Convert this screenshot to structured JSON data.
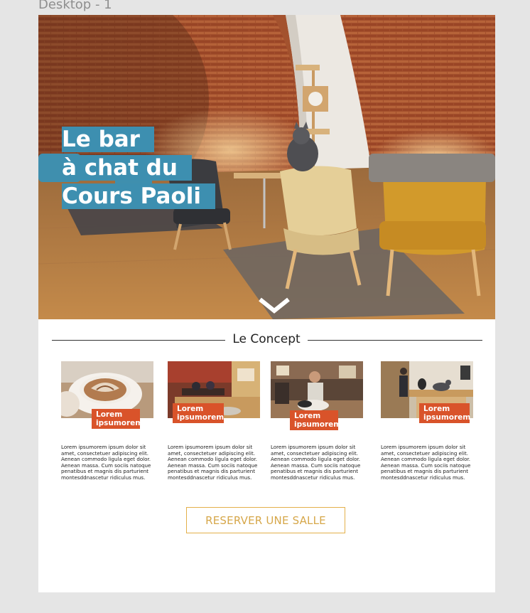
{
  "canvas": {
    "frame_label": "Desktop - 1"
  },
  "hero": {
    "title_lines": [
      "Le bar",
      "à chat du",
      "Cours Paoli"
    ],
    "scroll_icon": "chevron-down-icon"
  },
  "concept": {
    "heading": "Le Concept",
    "cards": [
      {
        "tag": "Lorem ipsumorem",
        "photo": "coffee-cup-photo",
        "desc": "Lorem ipsumorem ipsum dolor sit amet, consectetuer adipiscing elit. Aenean commodo ligula eget dolor. Aenean massa. Cum sociis natoque penatibus et magnis dis parturient montesddnascetur ridiculus mus."
      },
      {
        "tag": "Lorem ipsumorem",
        "photo": "cafe-interior-photo",
        "desc": "Lorem ipsumorem ipsum dolor sit amet, consectetuer adipiscing elit. Aenean commodo ligula eget dolor. Aenean massa. Cum sociis natoque penatibus et magnis dis parturient montesddnascetur ridiculus mus."
      },
      {
        "tag": "Lorem ipsumorem",
        "photo": "woman-with-cats-photo",
        "desc": "Lorem ipsumorem ipsum dolor sit amet, consectetuer adipiscing elit. Aenean commodo ligula eget dolor. Aenean massa. Cum sociis natoque penatibus et magnis dis parturient montesddnascetur ridiculus mus."
      },
      {
        "tag": "Lorem ipsumorem",
        "photo": "cats-at-counter-photo",
        "desc": "Lorem ipsumorem ipsum dolor sit amet, consectetuer adipiscing elit. Aenean commodo ligula eget dolor. Aenean massa. Cum sociis natoque penatibus et magnis dis parturient montesddnascetur ridiculus mus."
      }
    ]
  },
  "cta": {
    "reserve_label": "RESERVER UNE SALLE"
  },
  "colors": {
    "accent_blue": "#3d8fb0",
    "tag_orange": "#d9532a",
    "cta_gold": "#e3b04b"
  }
}
